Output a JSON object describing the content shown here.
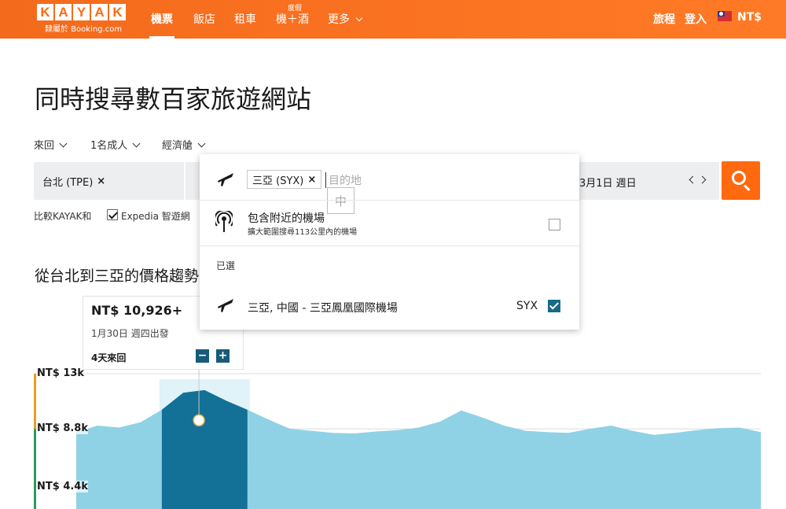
{
  "header": {
    "logo_letters": [
      "K",
      "A",
      "Y",
      "A",
      "K"
    ],
    "logo_sub": "隸屬於 Booking.com",
    "nav": [
      {
        "label": "機票"
      },
      {
        "label": "飯店"
      },
      {
        "label": "租車"
      },
      {
        "label": "機＋酒"
      },
      {
        "label": "更多"
      }
    ],
    "nav_badge": "度假",
    "trips": "旅程",
    "login": "登入",
    "currency": "NT$"
  },
  "page_title": "同時搜尋數百家旅遊網站",
  "options": {
    "trip_type": "來回",
    "travelers": "1名成人",
    "cabin": "經濟艙"
  },
  "search": {
    "origin": "台北 (TPE)",
    "date_text": "3月1日 週日"
  },
  "compare": {
    "label": "比較KAYAK和",
    "provider": "Expedia 智遊網",
    "checked": true
  },
  "trend_title": "從台北到三亞的價格趨勢",
  "price_card": {
    "price": "NT$ 10,926+",
    "date": "1月30日 週四出發",
    "trip_length": "4天來回",
    "minus": "−",
    "plus": "+"
  },
  "destination_panel": {
    "chip": "三亞 (SYX)",
    "placeholder": "目的地",
    "ime_char": "中",
    "nearby_label": "包含附近的機場",
    "nearby_sub": "擴大範圍搜尋113公里內的機場",
    "selected_header": "已選",
    "airport_name": "三亞, 中國 - 三亞鳳凰國際機場",
    "airport_code": "SYX"
  },
  "chart_data": {
    "type": "area",
    "title": "從台北到三亞的價格趨勢",
    "ylabel": "",
    "xlabel": "",
    "ytick_labels": [
      "NT$ 13k",
      "NT$ 8.8k",
      "NT$ 4.4k"
    ],
    "yticks": [
      13000,
      8800,
      4400
    ],
    "ylim": [
      2700,
      13300
    ],
    "highlight_range_index": [
      4,
      8
    ],
    "highlight_point_index": 5,
    "values": [
      8550,
      9050,
      8900,
      9300,
      10250,
      11550,
      11750,
      10950,
      10250,
      9500,
      8800,
      8650,
      8500,
      8450,
      8600,
      8700,
      8900,
      9350,
      10200,
      9650,
      9050,
      8650,
      8550,
      8500,
      8800,
      9050,
      8650,
      8350,
      8500,
      8700,
      8850,
      8900,
      8550
    ]
  }
}
